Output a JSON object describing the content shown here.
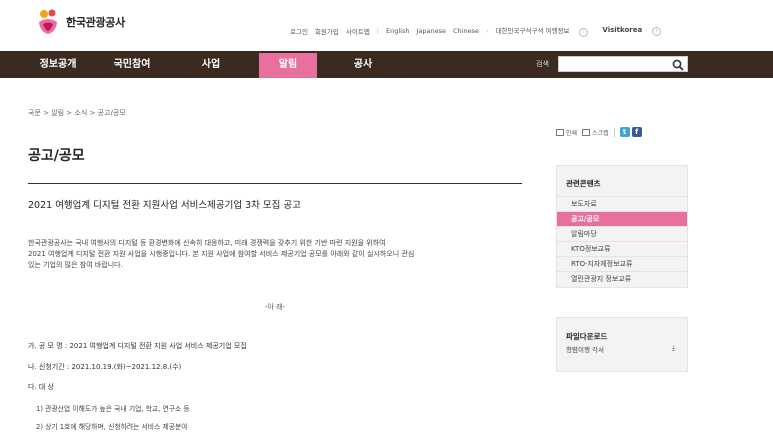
{
  "header": {
    "logo_text": "한국관광공사",
    "util_links": [
      "로그인",
      "회원가입",
      "사이트맵"
    ],
    "lang_links": [
      "English",
      "Japanese",
      "Chinese"
    ],
    "promo1": "대한민국구석구석 여행정보",
    "promo2": "Visitkorea"
  },
  "gnb": {
    "items": [
      "정보공개",
      "국민참여",
      "사업",
      "알림",
      "공사"
    ],
    "active": "알림",
    "search_label": "검색",
    "search_placeholder": ""
  },
  "breadcrumb": "국문 > 알림 > 소식 > 공고/공모",
  "page_title": "공고/공모",
  "notice": {
    "title": "2021 여행업계 디지털 전환 지원사업 서비스제공기업 3차 모집 공고",
    "para_lines": [
      "한국관광공사는 국내 여행사의 디지털 등 환경변화에 신속히 대응하고, 미래 경쟁력을 갖추기 위한 기반 마련 지원을 위하여",
      "2021 여행업계 디지털 전환 지원 사업을 시행중입니다. 본 지원 사업에 참여할 서비스 제공기업 공모를 아래와 같이 실시하오니 관심",
      "있는 기업의 많은 참여 바랍니다."
    ],
    "center_note": "-아 래-",
    "items": [
      "가. 공 모 명 : 2021 여행업계 디지털 전환 지원 사업 서비스 제공기업 모집",
      "나. 신청기간 : 2021.10.19.(화)~2021.12.8.(수)",
      "다. 대 상"
    ],
    "sub_items": [
      "1) 관광산업 이해도가 높은 국내 기업, 학교, 연구소 등",
      "2) 상기 1호에 해당하며, 신청하려는 서비스 제공분야"
    ]
  },
  "tools": {
    "print": "인쇄",
    "scrap": "스크랩"
  },
  "sidebar": {
    "related_title": "관련콘텐츠",
    "related_items": [
      "보도자료",
      "공고/공모",
      "알림마당",
      "KTO정보교류",
      "RTO·지자체정보교류",
      "열린관광지 정보교류"
    ],
    "active": "공고/공모",
    "download_title": "파일다운로드",
    "download_item": "청렴이행 각서"
  },
  "colors": {
    "gnb_bg": "#3a2a20",
    "accent": "#e8709e"
  }
}
